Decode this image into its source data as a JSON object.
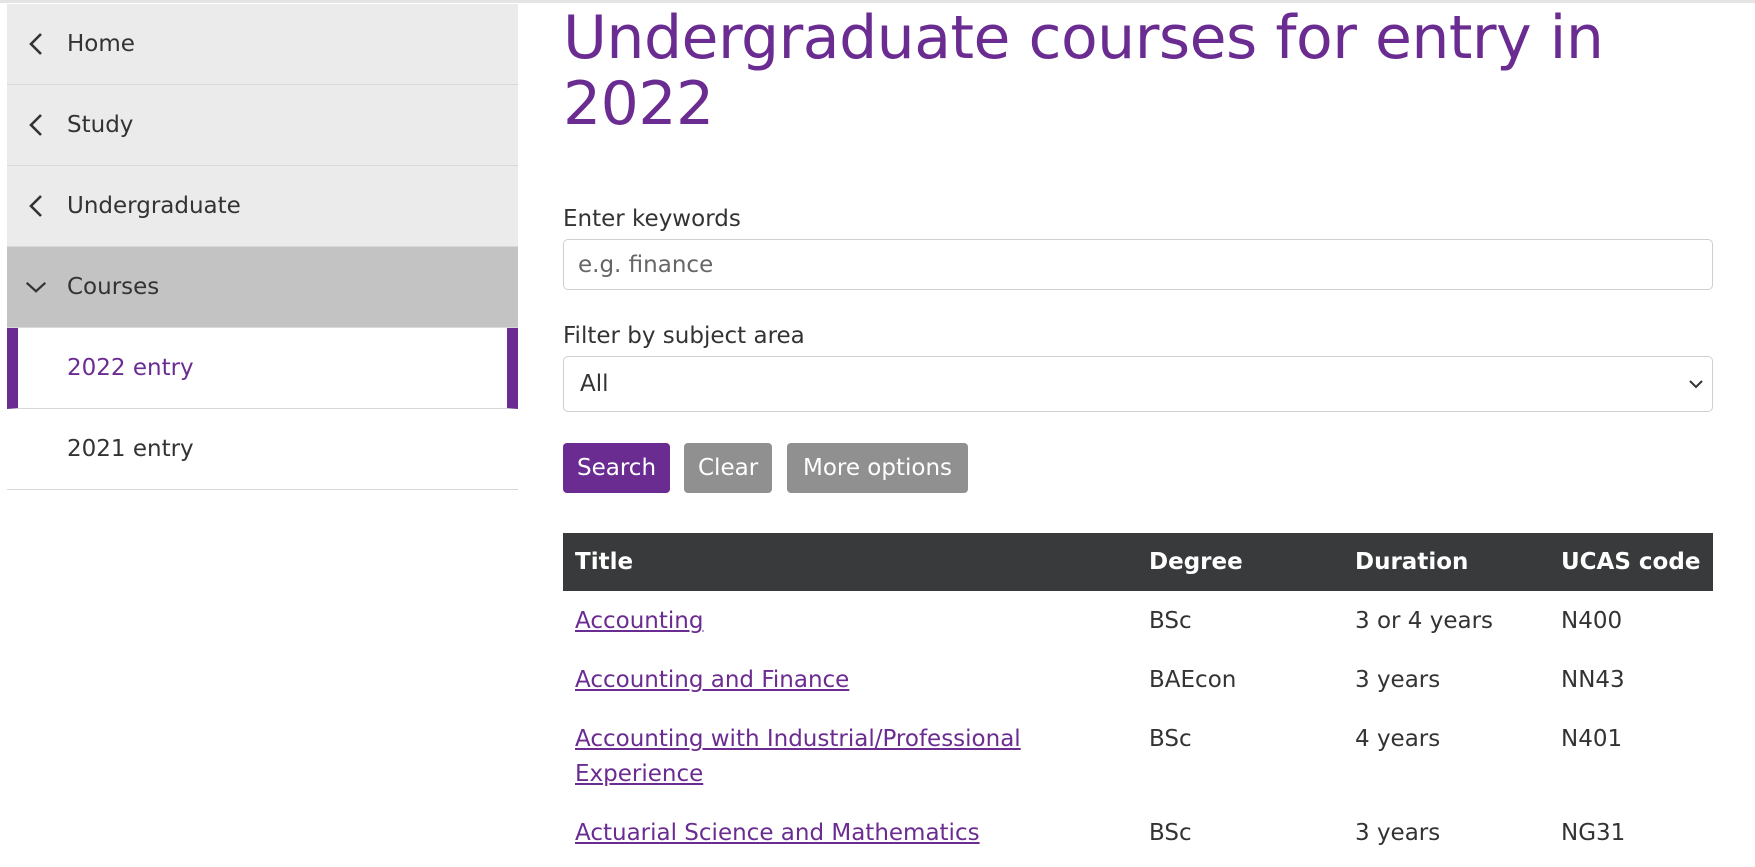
{
  "sidebar": {
    "items": [
      {
        "label": "Home",
        "type": "parent"
      },
      {
        "label": "Study",
        "type": "parent"
      },
      {
        "label": "Undergraduate",
        "type": "parent"
      },
      {
        "label": "Courses",
        "type": "open"
      },
      {
        "label": "2022 entry",
        "type": "active"
      },
      {
        "label": "2021 entry",
        "type": "child"
      }
    ]
  },
  "page": {
    "title": "Undergraduate courses for entry in 2022"
  },
  "search": {
    "keywords_label": "Enter keywords",
    "keywords_placeholder": "e.g. finance",
    "keywords_value": "",
    "subject_label": "Filter by subject area",
    "subject_selected": "All"
  },
  "buttons": {
    "search": "Search",
    "clear": "Clear",
    "more": "More options"
  },
  "table": {
    "headers": [
      "Title",
      "Degree",
      "Duration",
      "UCAS code"
    ],
    "rows": [
      {
        "title": "Accounting",
        "degree": "BSc",
        "duration": "3 or 4 years",
        "ucas": "N400"
      },
      {
        "title": "Accounting and Finance",
        "degree": "BAEcon",
        "duration": "3 years",
        "ucas": "NN43"
      },
      {
        "title": "Accounting with Industrial/Professional Experience",
        "degree": "BSc",
        "duration": "4 years",
        "ucas": "N401"
      },
      {
        "title": "Actuarial Science and Mathematics",
        "degree": "BSc",
        "duration": "3 years",
        "ucas": "NG31"
      }
    ]
  },
  "colors": {
    "accent": "#6b2c91",
    "table_header": "#383a3b",
    "button_grey": "#909090"
  },
  "icons": {
    "back": "chevron-left-icon",
    "expand": "chevron-down-icon",
    "select": "chevron-down-icon"
  }
}
